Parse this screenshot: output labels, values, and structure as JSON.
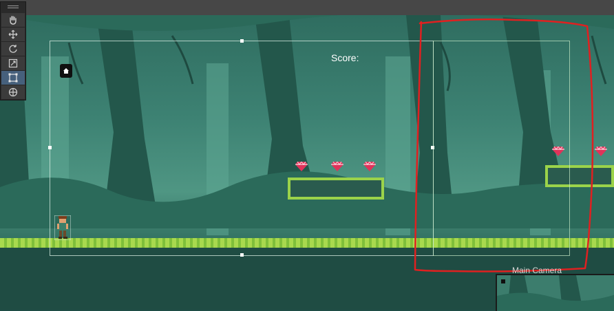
{
  "hud": {
    "score_label": "Score:"
  },
  "tool_palette": {
    "tools": [
      {
        "name": "hand-tool",
        "icon": "hand-icon"
      },
      {
        "name": "move-tool",
        "icon": "move-arrows-icon"
      },
      {
        "name": "rotate-tool",
        "icon": "rotate-icon"
      },
      {
        "name": "scale-tool",
        "icon": "scale-icon"
      },
      {
        "name": "rect-tool",
        "icon": "rect-transform-icon",
        "active": true
      },
      {
        "name": "transform-tool",
        "icon": "transform-icon"
      }
    ]
  },
  "camera_preview": {
    "title": "Main Camera"
  },
  "colors": {
    "toolbar_bg": "#2a2a2a",
    "active_tool": "#46607c",
    "grass": "#9bd34a",
    "gem": "#e0335a",
    "annotation": "#e02020"
  }
}
